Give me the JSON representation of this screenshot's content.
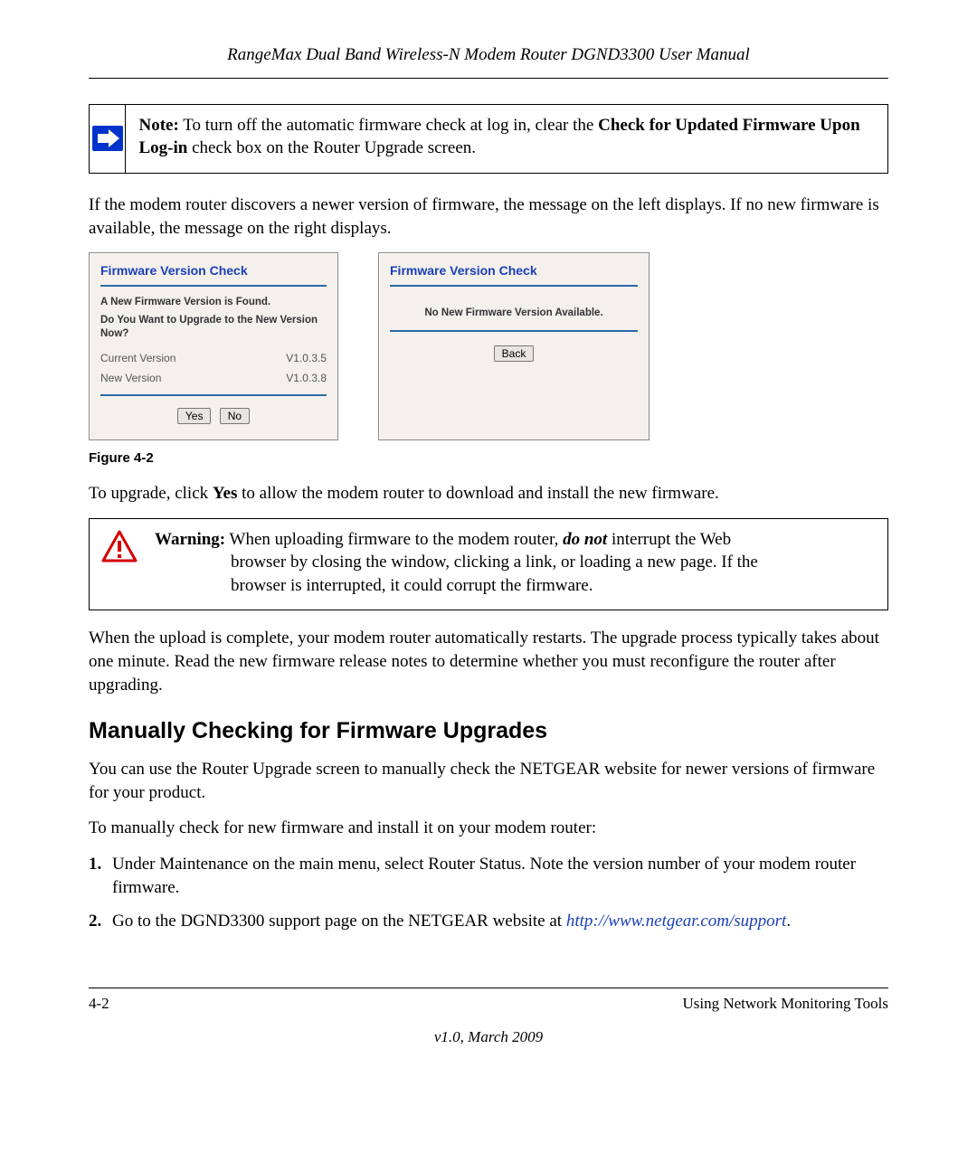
{
  "header": {
    "title": "RangeMax Dual Band Wireless-N Modem Router DGND3300 User Manual"
  },
  "note": {
    "label": "Note:",
    "text_before": " To turn off the automatic firmware check at log in, clear the ",
    "bold1": "Check for Updated Firmware Upon Log-in",
    "text_after": " check box on the Router Upgrade screen."
  },
  "p_intro": "If the modem router discovers a newer version of firmware, the message on the left displays. If no new firmware is available, the message on the right displays.",
  "dialog_left": {
    "title": "Firmware Version Check",
    "found_msg": "A New Firmware Version is Found.",
    "upgrade_q": "Do You Want to Upgrade to the New Version Now?",
    "current_label": "Current Version",
    "current_value": "V1.0.3.5",
    "new_label": "New Version",
    "new_value": "V1.0.3.8",
    "yes_btn": "Yes",
    "no_btn": "No"
  },
  "dialog_right": {
    "title": "Firmware Version Check",
    "none_msg": "No New Firmware Version Available.",
    "back_btn": "Back"
  },
  "figure_caption": "Figure 4-2",
  "p_upgrade_before": "To upgrade, click ",
  "p_upgrade_bold": "Yes",
  "p_upgrade_after": " to allow the modem router to download and install the new firmware.",
  "warning": {
    "label": "Warning:",
    "line1_a": " When uploading firmware to the modem router, ",
    "line1_em": "do not",
    "line1_b": " interrupt the Web",
    "line2": "browser by closing the window, clicking a link, or loading a new page. If the",
    "line3": "browser is interrupted, it could corrupt the firmware."
  },
  "p_upload_complete": "When the upload is complete, your modem router automatically restarts. The upgrade process typically takes about one minute. Read the new firmware release notes to determine whether you must reconfigure the router after upgrading.",
  "h2_manual": "Manually Checking for Firmware Upgrades",
  "p_manual_intro": "You can use the Router Upgrade screen to manually check the NETGEAR website for newer versions of firmware for your product.",
  "p_manual_lead": "To manually check for new firmware and install it on your modem router:",
  "steps": {
    "s1": "Under Maintenance on the main menu, select Router Status. Note the version number of your modem router firmware.",
    "s2_a": "Go to the DGND3300 support page on the NETGEAR website at ",
    "s2_link": "http://www.netgear.com/support",
    "s2_b": "."
  },
  "footer": {
    "page_num": "4-2",
    "section": "Using Network Monitoring Tools",
    "version": "v1.0, March 2009"
  }
}
